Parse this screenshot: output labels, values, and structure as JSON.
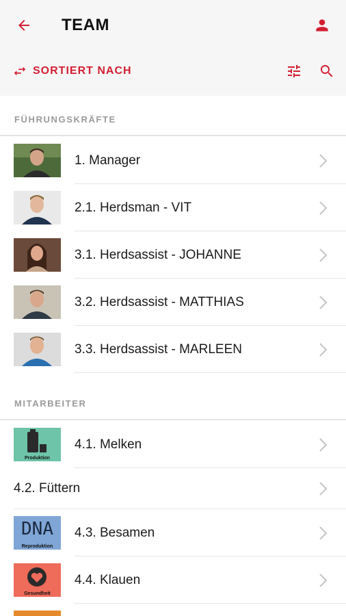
{
  "header": {
    "title": "TEAM",
    "sort_label": "SORTIERT NACH",
    "accent_color": "#d21f32",
    "icons": {
      "back": "arrow-left-icon",
      "profile": "person-icon",
      "sort": "swap-arrows-icon",
      "filter": "sliders-icon",
      "search": "search-icon"
    }
  },
  "sections": {
    "leaders": {
      "title": "FÜHRUNGSKRÄFTE",
      "items": [
        {
          "label": "1. Manager"
        },
        {
          "label": "2.1. Herdsman - VIT"
        },
        {
          "label": "3.1. Herdsassist - JOHANNE"
        },
        {
          "label": "3.2. Herdsassist - MATTHIAS"
        },
        {
          "label": "3.3. Herdsassist - MARLEEN"
        }
      ]
    },
    "staff": {
      "title": "MITARBEITER",
      "items": [
        {
          "label": "4.1. Melken",
          "thumb_caption": "Produktion"
        },
        {
          "label": "4.2. Füttern"
        },
        {
          "label": "4.3. Besamen",
          "thumb_text": "DNA",
          "thumb_caption": "Reproduktion"
        },
        {
          "label": "4.4. Klauen",
          "thumb_caption": "Gesundheit"
        }
      ]
    }
  }
}
